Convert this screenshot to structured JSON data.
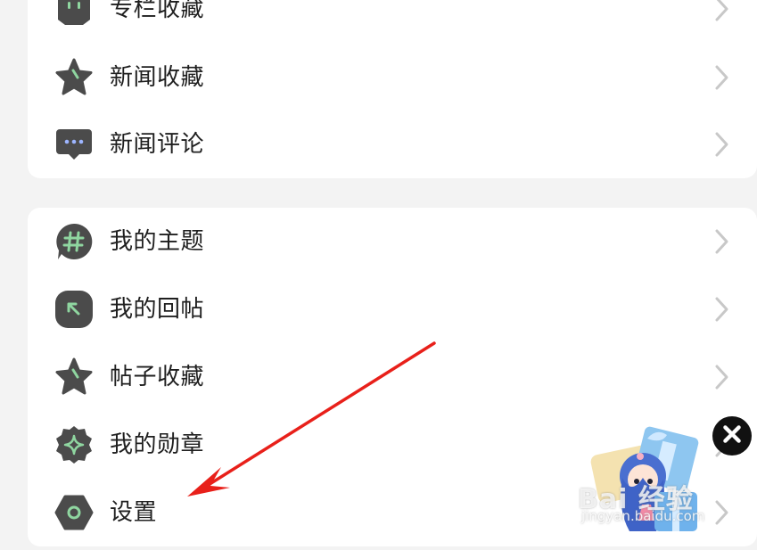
{
  "group1": {
    "items": [
      {
        "label": "专栏收藏",
        "icon": "column-icon"
      },
      {
        "label": "新闻收藏",
        "icon": "star-icon"
      },
      {
        "label": "新闻评论",
        "icon": "comment-icon"
      }
    ]
  },
  "group2": {
    "items": [
      {
        "label": "我的主题",
        "icon": "hashtag-icon"
      },
      {
        "label": "我的回帖",
        "icon": "reply-arrow-icon"
      },
      {
        "label": "帖子收藏",
        "icon": "star-icon"
      },
      {
        "label": "我的勋章",
        "icon": "medal-icon"
      },
      {
        "label": "设置",
        "icon": "hexagon-settings-icon"
      }
    ]
  },
  "colors": {
    "icon_bg": "#4b4b4b",
    "icon_accent": "#8fd6a0",
    "annotation_arrow": "#e8201a",
    "chevron": "#c8c8c8"
  },
  "watermark": {
    "logo_text": "Bai 经验",
    "url_text": "jingyan.baidu.com"
  }
}
